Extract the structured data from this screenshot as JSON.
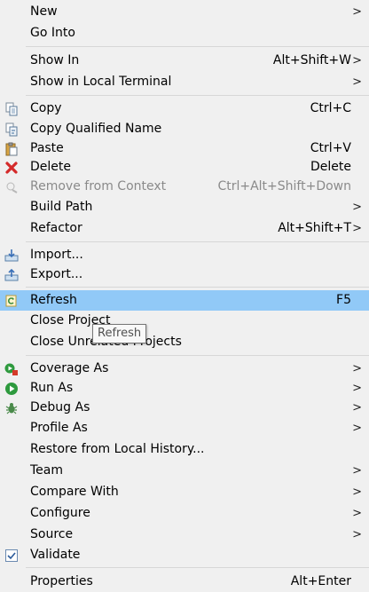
{
  "menu": {
    "items": [
      {
        "label": "New",
        "shortcut": "",
        "submenu": true
      },
      {
        "label": "Go Into",
        "shortcut": "",
        "submenu": false
      },
      {
        "label": "Show In",
        "shortcut": "Alt+Shift+W",
        "submenu": true
      },
      {
        "label": "Show in Local Terminal",
        "shortcut": "",
        "submenu": true
      },
      {
        "label": "Copy",
        "shortcut": "Ctrl+C",
        "submenu": false,
        "icon": "copy-icon"
      },
      {
        "label": "Copy Qualified Name",
        "shortcut": "",
        "submenu": false,
        "icon": "copy-qualified-name-icon"
      },
      {
        "label": "Paste",
        "shortcut": "Ctrl+V",
        "submenu": false,
        "icon": "paste-icon"
      },
      {
        "label": "Delete",
        "shortcut": "Delete",
        "submenu": false,
        "icon": "delete-icon"
      },
      {
        "label": "Remove from Context",
        "shortcut": "Ctrl+Alt+Shift+Down",
        "submenu": false,
        "icon": "remove-from-context-icon",
        "disabled": true
      },
      {
        "label": "Build Path",
        "shortcut": "",
        "submenu": true
      },
      {
        "label": "Refactor",
        "shortcut": "Alt+Shift+T",
        "submenu": true
      },
      {
        "label": "Import...",
        "shortcut": "",
        "submenu": false,
        "icon": "import-icon"
      },
      {
        "label": "Export...",
        "shortcut": "",
        "submenu": false,
        "icon": "export-icon"
      },
      {
        "label": "Refresh",
        "shortcut": "F5",
        "submenu": false,
        "icon": "refresh-icon",
        "highlighted": true
      },
      {
        "label": "Close Project",
        "shortcut": "",
        "submenu": false
      },
      {
        "label": "Close Unrelated Projects",
        "shortcut": "",
        "submenu": false
      },
      {
        "label": "Coverage As",
        "shortcut": "",
        "submenu": true,
        "icon": "coverage-icon"
      },
      {
        "label": "Run As",
        "shortcut": "",
        "submenu": true,
        "icon": "run-icon"
      },
      {
        "label": "Debug As",
        "shortcut": "",
        "submenu": true,
        "icon": "debug-icon"
      },
      {
        "label": "Profile As",
        "shortcut": "",
        "submenu": true
      },
      {
        "label": "Restore from Local History...",
        "shortcut": "",
        "submenu": false
      },
      {
        "label": "Team",
        "shortcut": "",
        "submenu": true
      },
      {
        "label": "Compare With",
        "shortcut": "",
        "submenu": true
      },
      {
        "label": "Configure",
        "shortcut": "",
        "submenu": true
      },
      {
        "label": "Source",
        "shortcut": "",
        "submenu": true
      },
      {
        "label": "Validate",
        "shortcut": "",
        "submenu": false,
        "icon": "checkbox-checked-icon"
      },
      {
        "label": "Properties",
        "shortcut": "Alt+Enter",
        "submenu": false
      }
    ],
    "submenu_arrow": ">"
  },
  "tooltip": {
    "text": "Refresh"
  },
  "colors": {
    "background": "#f0f0f0",
    "highlight": "#91c9f7",
    "separator": "#d7d7d7",
    "disabled_text": "#8a8a8a"
  }
}
